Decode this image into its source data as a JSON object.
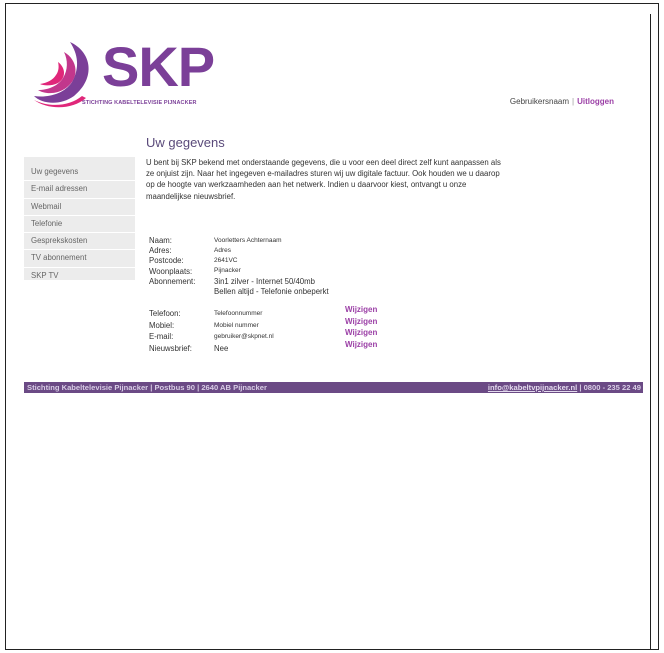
{
  "brand": {
    "name": "SKP",
    "tagline": "STICHTING KABELTELEVISIE PIJNACKER",
    "colors": {
      "purple": "#7b3f98",
      "magenta": "#e0277a",
      "footer": "#6b4a85"
    }
  },
  "userbar": {
    "username": "Gebruikersnaam",
    "separator": "|",
    "logout": "Uitloggen"
  },
  "page": {
    "title": "Uw gegevens",
    "intro": "U bent bij SKP bekend met onderstaande gegevens, die u voor een deel direct zelf kunt aanpassen als ze onjuist zijn. Naar het ingegeven e-mailadres sturen wij uw digitale factuur. Ook houden we u daarop op de hoogte van werkzaamheden aan het netwerk. Indien u daarvoor kiest, ontvangt u onze maandelijkse nieuwsbrief."
  },
  "sidebar": {
    "items": [
      {
        "label": "Uw gegevens"
      },
      {
        "label": "E-mail adressen"
      },
      {
        "label": "Webmail"
      },
      {
        "label": "Telefonie"
      },
      {
        "label": "Gesprekskosten"
      },
      {
        "label": "TV abonnement"
      },
      {
        "label": "SKP TV"
      }
    ]
  },
  "details": {
    "name_label": "Naam:",
    "name_value": "Voorletters Achternaam",
    "address_label": "Adres:",
    "address_value": "Adres",
    "postcode_label": "Postcode:",
    "postcode_value": "2641VC",
    "city_label": "Woonplaats:",
    "city_value": "Pijnacker",
    "subscription_label": "Abonnement:",
    "subscription_line1": "3in1 zilver - Internet 50/40mb",
    "subscription_line2": "Bellen altijd - Telefonie onbeperkt"
  },
  "contact": {
    "edit_label": "Wijzigen",
    "phone_label": "Telefoon:",
    "phone_value": "Telefoonnummer",
    "mobile_label": "Mobiel:",
    "mobile_value": "Mobiel nummer",
    "email_label": "E-mail:",
    "email_value": "gebruiker@skpnet.nl",
    "newsletter_label": "Nieuwsbrief:",
    "newsletter_value": "Nee"
  },
  "footer": {
    "address": "Stichting Kabeltelevisie Pijnacker | Postbus 90 | 2640 AB Pijnacker",
    "email": "info@kabeltvpijnacker.nl",
    "phone": "| 0800 - 235 22 49"
  }
}
